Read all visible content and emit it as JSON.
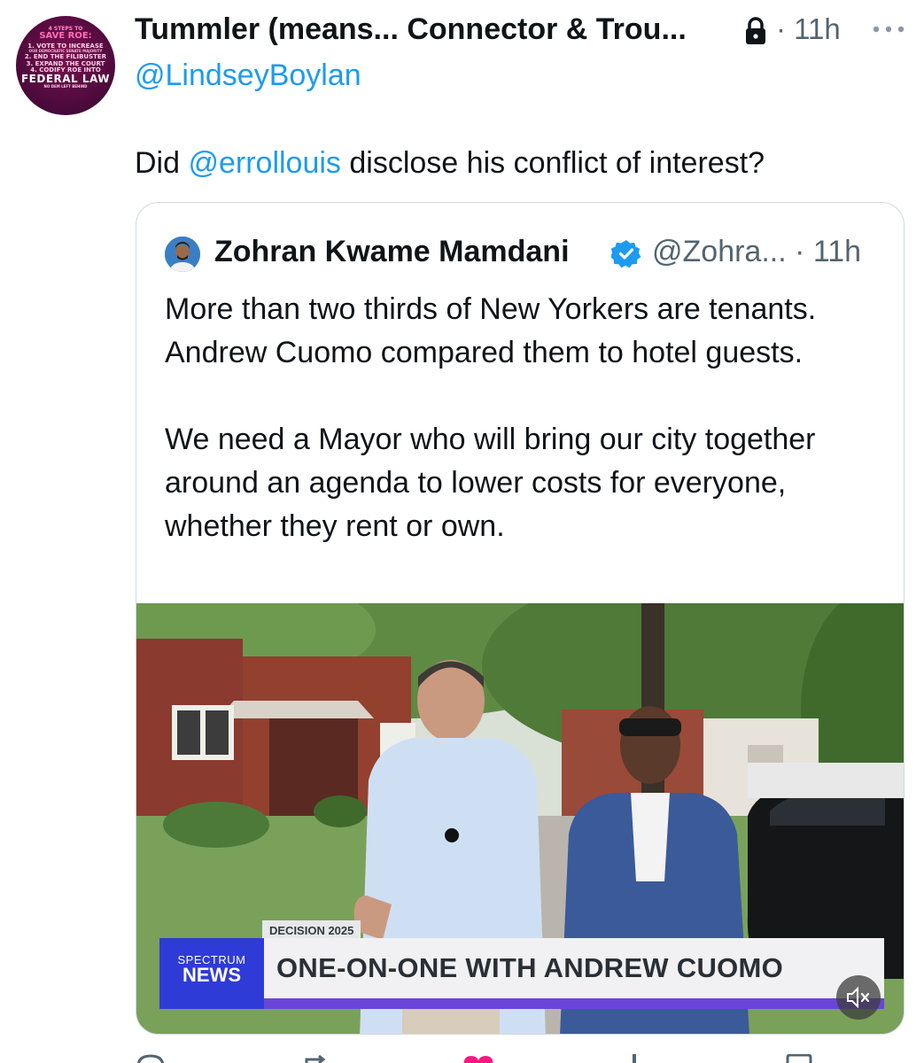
{
  "author": {
    "display_name": "Tummler (means... Connector & Trou...",
    "handle": "@LindseyBoylan",
    "time": "· 11h",
    "avatar_text": {
      "line0": "4 STEPS TO",
      "line1": "SAVE ROE:",
      "line2": "1. VOTE TO INCREASE",
      "line3": "OUR DEMOCRATIC SENATE MAJORITY",
      "line4": "2. END THE FILIBUSTER",
      "line5": "3. EXPAND THE COURT",
      "line6": "4. CODIFY ROE INTO",
      "line7": "FEDERAL LAW",
      "line8": "NO DEM LEFT BEHIND"
    }
  },
  "tweet": {
    "prefix": "Did ",
    "mention": "@errollouis",
    "suffix": " disclose his conflict of interest?"
  },
  "quote": {
    "display_name": "Zohran Kwame Mamdani",
    "handle_time": "@Zohra... · 11h",
    "paragraph1": "More than two thirds of New Yorkers are tenants. Andrew Cuomo compared them to hotel guests.",
    "paragraph2": "We need a Mayor who will bring our city together around an agenda to lower costs for everyone, whether they rent or own.",
    "video": {
      "tag": "DECISION 2025",
      "logo_line1": "SPECTRUM",
      "logo_line2": "NEWS",
      "headline": "ONE-ON-ONE WITH ANDREW CUOMO"
    }
  },
  "colors": {
    "link": "#1d9bf0",
    "secondary_text": "#536471",
    "border": "#cfd9de",
    "spectrum_blue": "#2f3bd6",
    "chyron_stripe": "#6b45d9",
    "like": "#f91880"
  },
  "icons": [
    "lock-icon",
    "more-icon",
    "verified-icon",
    "mute-icon",
    "reply-icon",
    "retweet-icon",
    "like-icon",
    "views-icon",
    "bookmark-icon"
  ]
}
